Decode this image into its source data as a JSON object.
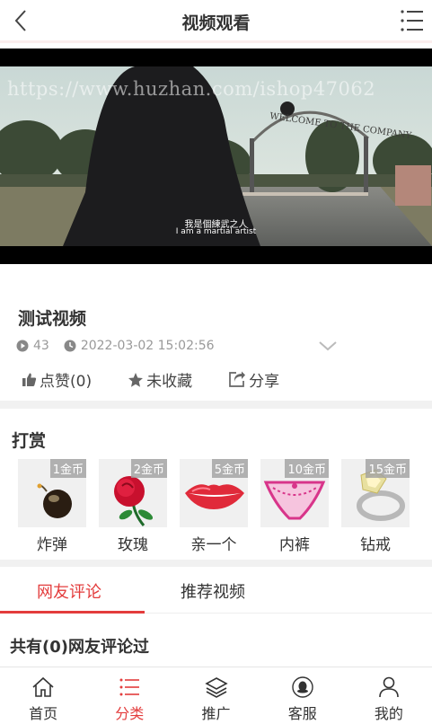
{
  "header": {
    "title": "视频观看"
  },
  "video": {
    "watermark": "https://www.huzhan.com/ishop47062",
    "subtitle_cn": "我是個練武之人",
    "subtitle_en": "I am a martial artist",
    "sign_text": "WELCOME TO THE COMPANY"
  },
  "info": {
    "title": "测试视频",
    "plays": "43",
    "datetime": "2022-03-02 15:02:56",
    "like_label": "点赞(0)",
    "favorite_label": "未收藏",
    "share_label": "分享"
  },
  "reward": {
    "title": "打赏",
    "gifts": [
      {
        "name": "炸弹",
        "price": "1金币",
        "icon": "bomb-icon"
      },
      {
        "name": "玫瑰",
        "price": "2金币",
        "icon": "rose-icon"
      },
      {
        "name": "亲一个",
        "price": "5金币",
        "icon": "lips-icon"
      },
      {
        "name": "内裤",
        "price": "10金币",
        "icon": "underwear-icon"
      },
      {
        "name": "钻戒",
        "price": "15金币",
        "icon": "diamond-ring-icon"
      }
    ]
  },
  "tabs": {
    "comments": "网友评论",
    "recommend": "推荐视频"
  },
  "comments": {
    "title": "共有(0)网友评论过"
  },
  "tabbar": {
    "items": [
      {
        "label": "首页",
        "icon": "home-icon"
      },
      {
        "label": "分类",
        "icon": "list-icon"
      },
      {
        "label": "推广",
        "icon": "layers-icon"
      },
      {
        "label": "客服",
        "icon": "service-icon"
      },
      {
        "label": "我的",
        "icon": "user-icon"
      }
    ],
    "active_index": 1
  },
  "colors": {
    "accent": "#e33c3c",
    "muted": "#999999",
    "separator": "#f1f1f1"
  }
}
